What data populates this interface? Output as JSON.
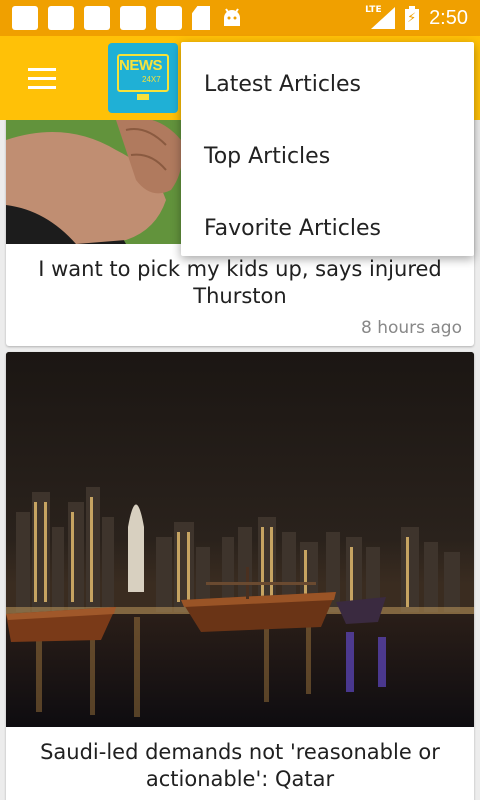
{
  "status_bar": {
    "lte_label": "LTE",
    "time": "2:50"
  },
  "app_bar": {
    "logo_text": "NEWS",
    "logo_sub": "24X7"
  },
  "menu": {
    "items": [
      {
        "label": "Latest Articles"
      },
      {
        "label": "Top Articles"
      },
      {
        "label": "Favorite Articles"
      }
    ]
  },
  "articles": [
    {
      "title": "I want to pick my kids up, says injured Thurston",
      "time": "8 hours ago"
    },
    {
      "title": "Saudi-led demands not 'reasonable or actionable': Qatar"
    }
  ],
  "colors": {
    "status_bar": "#f0a000",
    "app_bar": "#ffc107",
    "logo_bg": "#1fb0d6",
    "logo_accent": "#f8e23a"
  },
  "icons": [
    "notification-square-icon",
    "sd-card-icon",
    "android-icon",
    "lte-signal-icon",
    "battery-charging-icon",
    "hamburger-menu-icon"
  ]
}
